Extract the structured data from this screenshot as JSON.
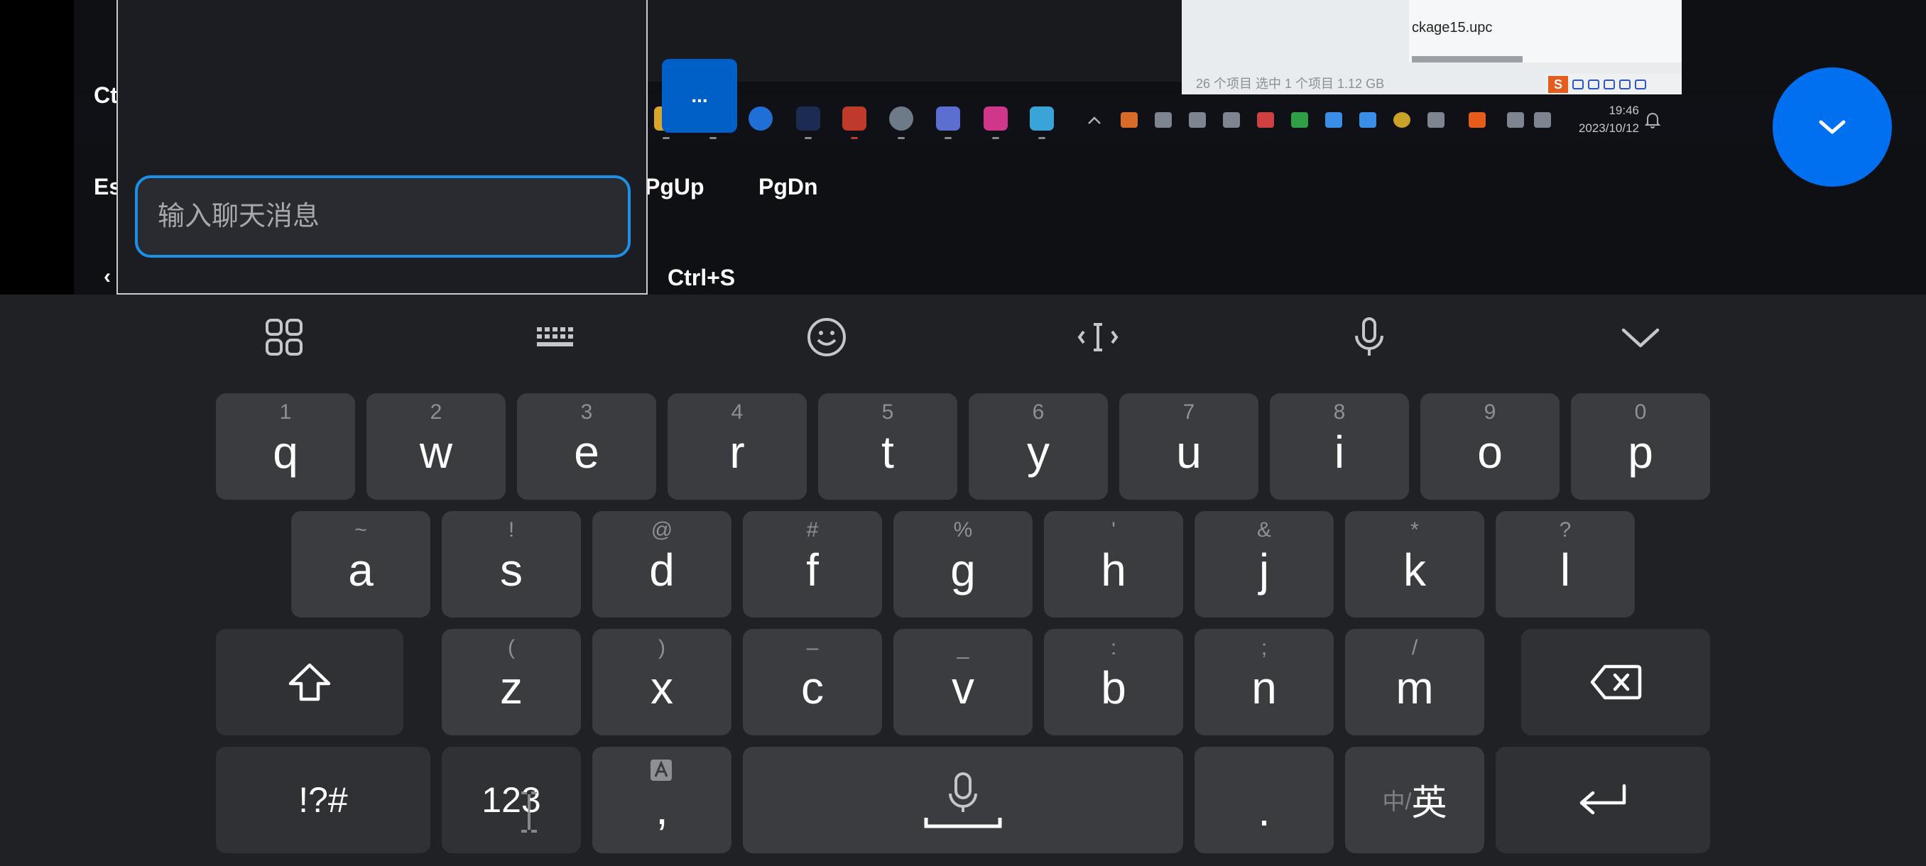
{
  "remote_desktop": {
    "file_label": "ckage15.upc",
    "status_text": "26 个项目   选中 1 个项目  1.12 GB",
    "ime_logo": "S",
    "clock_time": "19:46",
    "clock_date": "2023/10/12",
    "key_labels": {
      "ctrl_partial": "Ct",
      "esc_partial": "Es",
      "pgup": "PgUp",
      "pgdn": "PgDn",
      "ctrl_s": "Ctrl+S",
      "back_partial": "‹"
    },
    "more_button": "..."
  },
  "chat": {
    "placeholder": "输入聊天消息"
  },
  "keyboard": {
    "row1": [
      {
        "hint": "1",
        "key": "q"
      },
      {
        "hint": "2",
        "key": "w"
      },
      {
        "hint": "3",
        "key": "e"
      },
      {
        "hint": "4",
        "key": "r"
      },
      {
        "hint": "5",
        "key": "t"
      },
      {
        "hint": "6",
        "key": "y"
      },
      {
        "hint": "7",
        "key": "u"
      },
      {
        "hint": "8",
        "key": "i"
      },
      {
        "hint": "9",
        "key": "o"
      },
      {
        "hint": "0",
        "key": "p"
      }
    ],
    "row2": [
      {
        "hint": "~",
        "key": "a"
      },
      {
        "hint": "!",
        "key": "s"
      },
      {
        "hint": "@",
        "key": "d"
      },
      {
        "hint": "#",
        "key": "f"
      },
      {
        "hint": "%",
        "key": "g"
      },
      {
        "hint": "'",
        "key": "h"
      },
      {
        "hint": "&",
        "key": "j"
      },
      {
        "hint": "*",
        "key": "k"
      },
      {
        "hint": "?",
        "key": "l"
      }
    ],
    "row3": [
      {
        "hint": "(",
        "key": "z"
      },
      {
        "hint": ")",
        "key": "x"
      },
      {
        "hint": "–",
        "key": "c"
      },
      {
        "hint": "_",
        "key": "v"
      },
      {
        "hint": ":",
        "key": "b"
      },
      {
        "hint": ";",
        "key": "n"
      },
      {
        "hint": "/",
        "key": "m"
      }
    ],
    "symbols_key": "!?#",
    "numbers_key": "123",
    "comma_key": ",",
    "period_key": ".",
    "lang_key_prefix": "中/",
    "lang_key_main": "英"
  },
  "colors": {
    "accent": "#0070f0",
    "input_border": "#1e8fe6",
    "keyboard_bg": "#202124",
    "key_bg": "#3b3c40"
  }
}
